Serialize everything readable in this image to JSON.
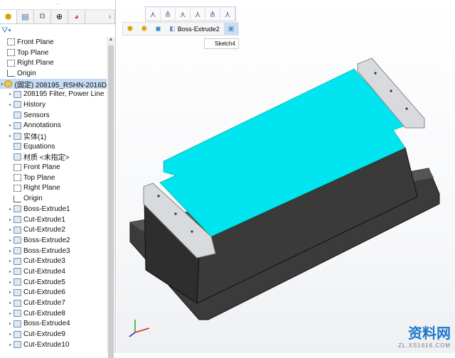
{
  "sidebar": {
    "tabs": [
      "feature-manager",
      "property-manager",
      "configuration-manager",
      "dimxpert-manager",
      "display-manager"
    ],
    "items": [
      {
        "label": "Front Plane",
        "icon": "plane",
        "exp": false
      },
      {
        "label": "Top Plane",
        "icon": "plane",
        "exp": false
      },
      {
        "label": "Right Plane",
        "icon": "plane",
        "exp": false
      },
      {
        "label": "Origin",
        "icon": "origin",
        "exp": false
      },
      {
        "label": "(固定) 208195_RSHN-2016D",
        "icon": "part",
        "exp": true,
        "selected": true
      },
      {
        "label": "208195 Filter, Power Line",
        "icon": "folder",
        "exp": true
      },
      {
        "label": "History",
        "icon": "folder",
        "exp": true
      },
      {
        "label": "Sensors",
        "icon": "folder",
        "exp": false
      },
      {
        "label": "Annotations",
        "icon": "folder",
        "exp": true
      },
      {
        "label": "实体(1)",
        "icon": "folder",
        "exp": true
      },
      {
        "label": "Equations",
        "icon": "folder",
        "exp": false
      },
      {
        "label": "材质 <未指定>",
        "icon": "folder",
        "exp": false
      },
      {
        "label": "Front Plane",
        "icon": "plane",
        "exp": false
      },
      {
        "label": "Top Plane",
        "icon": "plane",
        "exp": false
      },
      {
        "label": "Right Plane",
        "icon": "plane",
        "exp": false
      },
      {
        "label": "Origin",
        "icon": "origin",
        "exp": false
      },
      {
        "label": "Boss-Extrude1",
        "icon": "feature",
        "exp": true
      },
      {
        "label": "Cut-Extrude1",
        "icon": "feature",
        "exp": true
      },
      {
        "label": "Cut-Extrude2",
        "icon": "feature",
        "exp": true
      },
      {
        "label": "Boss-Extrude2",
        "icon": "feature",
        "exp": true
      },
      {
        "label": "Boss-Extrude3",
        "icon": "feature",
        "exp": true
      },
      {
        "label": "Cut-Extrude3",
        "icon": "feature",
        "exp": true
      },
      {
        "label": "Cut-Extrude4",
        "icon": "feature",
        "exp": true
      },
      {
        "label": "Cut-Extrude5",
        "icon": "feature",
        "exp": true
      },
      {
        "label": "Cut-Extrude6",
        "icon": "feature",
        "exp": true
      },
      {
        "label": "Cut-Extrude7",
        "icon": "feature",
        "exp": true
      },
      {
        "label": "Cut-Extrude8",
        "icon": "feature",
        "exp": true
      },
      {
        "label": "Boss-Extrude4",
        "icon": "feature",
        "exp": true
      },
      {
        "label": "Cut-Extrude9",
        "icon": "feature",
        "exp": true
      },
      {
        "label": "Cut-Extrude10",
        "icon": "feature",
        "exp": true
      }
    ]
  },
  "breadcrumb": {
    "current": "Boss-Extrude2",
    "sketch": "Sketch4"
  },
  "colors": {
    "selected_face": "#00e5f0",
    "body": "#3a3a3a",
    "selection": "#c5dcf2"
  },
  "watermark": {
    "title": "资料网",
    "url": "ZL.XS1616.COM"
  }
}
